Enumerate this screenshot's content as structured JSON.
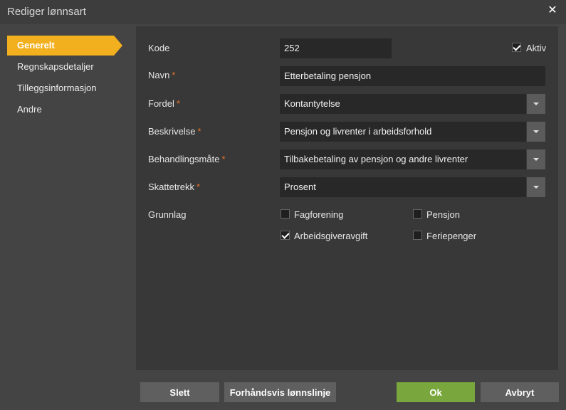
{
  "window": {
    "title": "Rediger lønnsart",
    "close_icon": "close-icon"
  },
  "sidebar": {
    "items": [
      {
        "label": "Generelt",
        "active": true
      },
      {
        "label": "Regnskapsdetaljer",
        "active": false
      },
      {
        "label": "Tilleggsinformasjon",
        "active": false
      },
      {
        "label": "Andre",
        "active": false
      }
    ]
  },
  "form": {
    "required_marker": "*",
    "kode": {
      "label": "Kode",
      "value": "252"
    },
    "aktiv": {
      "label": "Aktiv",
      "checked": true
    },
    "navn": {
      "label": "Navn",
      "value": "Etterbetaling pensjon"
    },
    "fordel": {
      "label": "Fordel",
      "value": "Kontantytelse"
    },
    "beskrivelse": {
      "label": "Beskrivelse",
      "value": "Pensjon og livrenter i arbeidsforhold"
    },
    "behandlingsmate": {
      "label": "Behandlingsmåte",
      "value": "Tilbakebetaling av pensjon og andre livrenter"
    },
    "skattetrekk": {
      "label": "Skattetrekk",
      "value": "Prosent"
    },
    "grunnlag": {
      "label": "Grunnlag",
      "options": [
        {
          "label": "Fagforening",
          "checked": false
        },
        {
          "label": "Pensjon",
          "checked": false
        },
        {
          "label": "Arbeidsgiveravgift",
          "checked": true
        },
        {
          "label": "Feriepenger",
          "checked": false
        }
      ]
    }
  },
  "footer": {
    "delete_label": "Slett",
    "preview_label": "Forhåndsvis lønnslinje",
    "ok_label": "Ok",
    "cancel_label": "Avbryt"
  },
  "colors": {
    "accent": "#f2b01f",
    "ok": "#7aa73d",
    "required": "#e8722a"
  }
}
